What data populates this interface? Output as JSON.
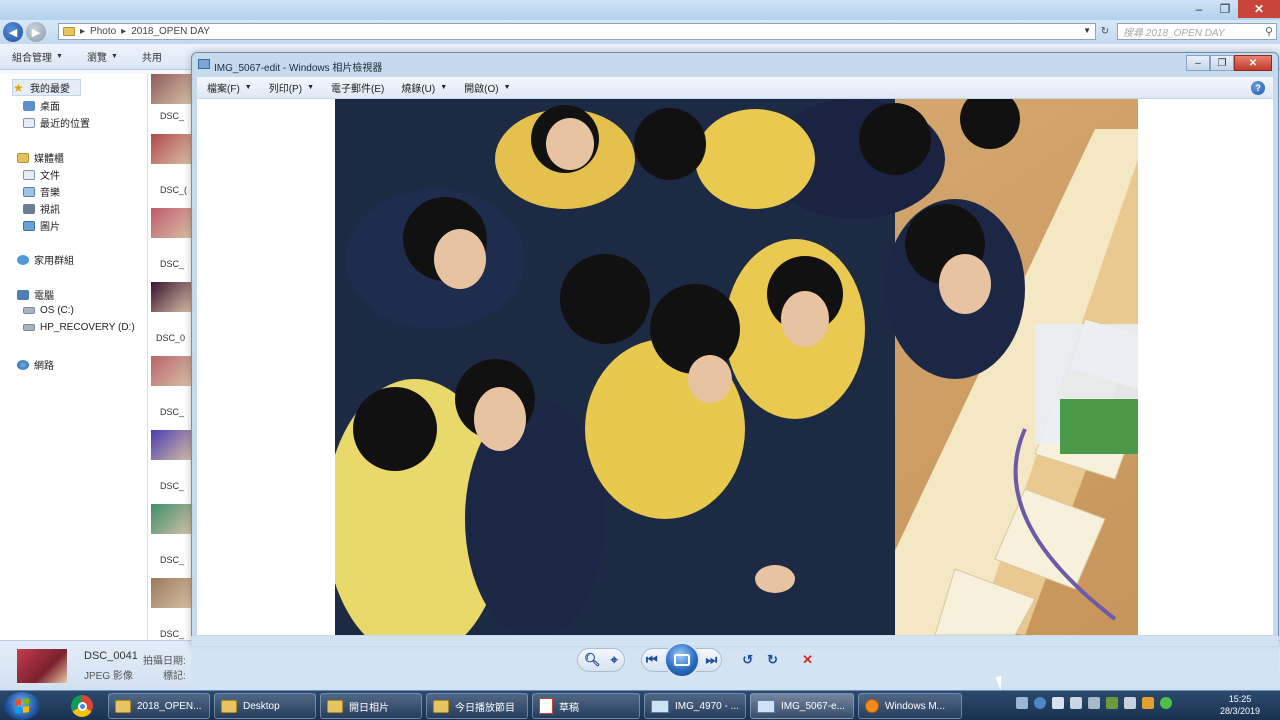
{
  "explorer": {
    "breadcrumb": [
      "Photo",
      "2018_OPEN DAY"
    ],
    "search_placeholder": "搜尋 2018_OPEN DAY",
    "toolbar": {
      "organize": "組合管理",
      "view": "瀏覽",
      "share": "共用"
    },
    "nav": {
      "favorites": "我的最愛",
      "desktop": "桌面",
      "recent": "最近的位置",
      "libraries": "媒體櫃",
      "documents": "文件",
      "music": "音樂",
      "videos": "視訊",
      "pictures": "圖片",
      "homegroup": "家用群組",
      "computer": "電腦",
      "os_drive": "OS (C:)",
      "recovery_drive": "HP_RECOVERY (D:)",
      "network": "網路"
    },
    "thumbnails": [
      {
        "label": "DSC_",
        "color": "#8f5b5b"
      },
      {
        "label": "DSC_(",
        "color": "#b24a4a"
      },
      {
        "label": "DSC_",
        "color": "#c05a6a"
      },
      {
        "label": "DSC_0",
        "color": "#3a1430"
      },
      {
        "label": "DSC_",
        "color": "#b8646a"
      },
      {
        "label": "DSC_",
        "color": "#4a3bb0"
      },
      {
        "label": "DSC_",
        "color": "#3c8f6a"
      },
      {
        "label": "DSC_",
        "color": "#9a7a5a"
      }
    ],
    "details": {
      "file_name": "DSC_0041",
      "date_label": "拍攝日期:",
      "file_type": "JPEG 影像",
      "rating_label": "標記:"
    }
  },
  "viewer": {
    "title": "IMG_5067-edit - Windows 相片檢視器",
    "menu": {
      "file": "檔案(F)",
      "print": "列印(P)",
      "email": "電子郵件(E)",
      "burn": "燒錄(U)",
      "open": "開啟(O)"
    }
  },
  "taskbar": {
    "buttons": [
      {
        "label": "2018_OPEN...",
        "icon": "folder"
      },
      {
        "label": "Desktop",
        "icon": "folder"
      },
      {
        "label": "開日相片",
        "icon": "folder"
      },
      {
        "label": "今日播放節目",
        "icon": "folder"
      },
      {
        "label": "草稿",
        "icon": "ppt"
      },
      {
        "label": "IMG_4970 - ...",
        "icon": "window"
      },
      {
        "label": "IMG_5067-e...",
        "icon": "window"
      },
      {
        "label": "Windows M...",
        "icon": "wmp"
      }
    ],
    "clock": {
      "time": "15:25",
      "date": "28/3/2019"
    }
  }
}
